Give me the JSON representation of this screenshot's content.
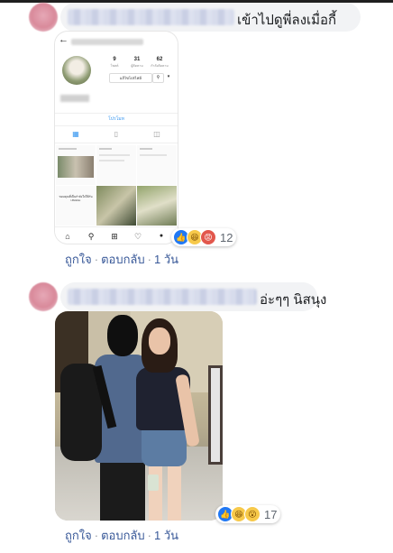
{
  "comments": [
    {
      "text": "เข้าไปดูพี่ลงเมื่อกี้",
      "actions": {
        "like": "ถูกใจ",
        "reply": "ตอบกลับ",
        "time": "1 วัน",
        "sep": "·"
      },
      "reactions": {
        "types": [
          "like-icon",
          "haha-icon",
          "angry-icon"
        ],
        "count": "12"
      },
      "attachment": {
        "type": "instagram-profile-screenshot",
        "stats": [
          {
            "num": "9",
            "label": "โพสต์"
          },
          {
            "num": "31",
            "label": "ผู้ติดตาม"
          },
          {
            "num": "62",
            "label": "กำลังติดตาม"
          }
        ],
        "edit_button": "แก้ไขโปรไฟล์",
        "promo_link": "โปรโมท",
        "post_caption": "ขอบคุณที่เป็นกำลังใจให้กันเสมอนะ"
      }
    },
    {
      "text": "อ่ะๆๆ นิสนุง",
      "actions": {
        "like": "ถูกใจ",
        "reply": "ตอบกลับ",
        "time": "1 วัน",
        "sep": "·"
      },
      "reactions": {
        "types": [
          "like-icon",
          "haha-icon",
          "wow-icon"
        ],
        "count": "17"
      },
      "attachment": {
        "type": "photo"
      }
    }
  ],
  "colors": {
    "link": "#385898",
    "bubble": "#f2f3f5",
    "ig_blue": "#3897f0"
  }
}
